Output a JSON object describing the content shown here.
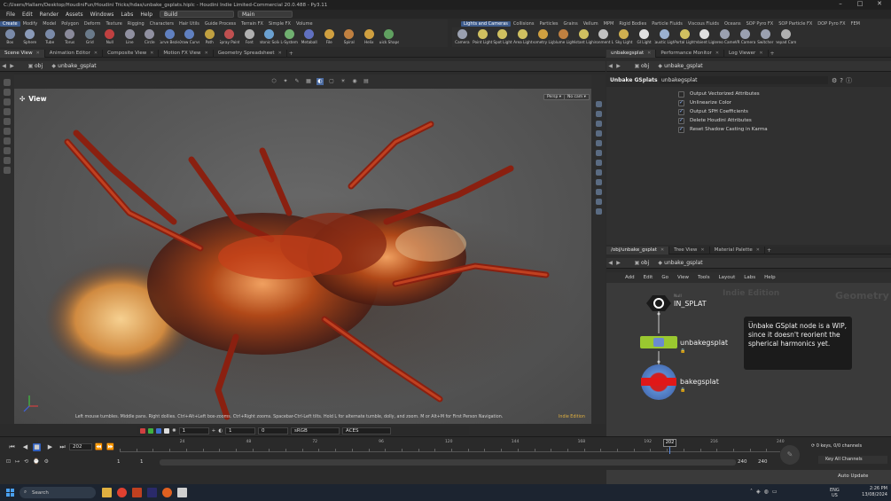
{
  "app": {
    "title": "C:/Users/Hallam/Desktop/HoudiniFun/Houdini Tricks/hdas/unbake_gsplats.hiplc - Houdini Indie Limited-Commercial 20.0.488 - Py3.11"
  },
  "menu": [
    "File",
    "Edit",
    "Render",
    "Assets",
    "Windows",
    "Labs",
    "Help"
  ],
  "desktops": {
    "build": "Build",
    "main": "Main"
  },
  "shelf_tabs_left": [
    "Create",
    "Modify",
    "Model",
    "Polygon",
    "Deform",
    "Texture",
    "Rigging",
    "Characters",
    "Hair Utils",
    "Guide Process",
    "Terrain FX",
    "Simple FX",
    "Volume"
  ],
  "shelf_tabs_right": [
    "Lights and Cameras",
    "Collisions",
    "Particles",
    "Grains",
    "Vellum",
    "MPM",
    "Rigid Bodies",
    "Particle Fluids",
    "Viscous Fluids",
    "Oceans",
    "SOP Pyro FX",
    "SOP Particle FX",
    "DOP Pyro FX",
    "FEM"
  ],
  "tools_left": [
    {
      "label": "Box",
      "color": "#7a8aa8"
    },
    {
      "label": "Sphere",
      "color": "#8a9ab8"
    },
    {
      "label": "Tube",
      "color": "#7a8aa8"
    },
    {
      "label": "Torus",
      "color": "#8a8a9a"
    },
    {
      "label": "Grid",
      "color": "#6a7a8a"
    },
    {
      "label": "Null",
      "color": "#c04040"
    },
    {
      "label": "Line",
      "color": "#9090a0"
    },
    {
      "label": "Circle",
      "color": "#9090a0"
    },
    {
      "label": "Curve Bezier",
      "color": "#6080c0"
    },
    {
      "label": "Draw Curve",
      "color": "#6080c0"
    },
    {
      "label": "Path",
      "color": "#c0a040"
    },
    {
      "label": "Spray Paint",
      "color": "#c05050"
    },
    {
      "label": "Font",
      "color": "#b0b0b0"
    },
    {
      "label": "Platonic Solids",
      "color": "#6aa0d0"
    },
    {
      "label": "L-System",
      "color": "#70b070"
    },
    {
      "label": "Metaball",
      "color": "#6070c0"
    },
    {
      "label": "File",
      "color": "#d0a040"
    },
    {
      "label": "Spiral",
      "color": "#c08040"
    },
    {
      "label": "Helix",
      "color": "#d0a040"
    },
    {
      "label": "Quick Shapes",
      "color": "#60a060"
    }
  ],
  "tools_right": [
    {
      "label": "Camera",
      "color": "#9aa0b0"
    },
    {
      "label": "Point Light",
      "color": "#d0c060"
    },
    {
      "label": "Spot Light",
      "color": "#d0c060"
    },
    {
      "label": "Area Light",
      "color": "#d0c060"
    },
    {
      "label": "Geometry Light",
      "color": "#d0a040"
    },
    {
      "label": "Volume Light",
      "color": "#c08040"
    },
    {
      "label": "Distant Light",
      "color": "#d0c060"
    },
    {
      "label": "Environment Light",
      "color": "#c0c0c0"
    },
    {
      "label": "Sky Light",
      "color": "#d0b050"
    },
    {
      "label": "GI Light",
      "color": "#e0e0e0"
    },
    {
      "label": "Caustic Light",
      "color": "#9ab0d0"
    },
    {
      "label": "Portal Light",
      "color": "#d0c060"
    },
    {
      "label": "Ambient Light",
      "color": "#e0e0e0"
    },
    {
      "label": "Stereo Camera",
      "color": "#9aa0b0"
    },
    {
      "label": "VR Camera",
      "color": "#9aa0b0"
    },
    {
      "label": "Switcher",
      "color": "#9aa0b0"
    },
    {
      "label": "Gamepad Camera",
      "color": "#b0b0b0"
    }
  ],
  "left_tabs": [
    {
      "label": "Scene View"
    },
    {
      "label": "Animation Editor"
    },
    {
      "label": "Composite View"
    },
    {
      "label": "Motion FX View"
    },
    {
      "label": "Geometry Spreadsheet"
    }
  ],
  "path": {
    "obj": "obj",
    "node": "unbake_gsplat"
  },
  "viewport": {
    "label": "View",
    "persp": "Persp ▾",
    "cam": "No cam ▾",
    "hint": "Left mouse tumbles. Middle pans. Right dollies. Ctrl+Alt+Left box-zooms. Ctrl+Right zooms. Spacebar-Ctrl-Left tilts. Hold L for alternate tumble, dolly, and zoom. M or Alt+M for First Person Navigation.",
    "edition": "Indie Edition"
  },
  "vpfoot": {
    "f1": "1",
    "f2": "1",
    "f3": "0",
    "cs": "sRGB",
    "aces": "ACES"
  },
  "timeline": {
    "frame": "202",
    "marker": "202",
    "start1": "1",
    "start2": "1",
    "end1": "240",
    "end2": "240",
    "keys": "0 keys, 0/0 channels",
    "keyall": "Key All Channels",
    "autoupdate": "Auto Update",
    "ticks": [
      "24",
      "48",
      "72",
      "96",
      "120",
      "144",
      "168",
      "192",
      "216",
      "240"
    ]
  },
  "right_top_tabs": [
    {
      "label": "unbakegsplat"
    },
    {
      "label": "Performance Monitor"
    },
    {
      "label": "Log Viewer"
    }
  ],
  "params": {
    "type": "Unbake GSplats",
    "name": "unbakegsplat",
    "items": [
      {
        "label": "Output Vectorized Attributes",
        "on": false
      },
      {
        "label": "Unlinearize Color",
        "on": true
      },
      {
        "label": "Output SPH Coefficients",
        "on": true
      },
      {
        "label": "Delete Houdini Attributes",
        "on": true
      },
      {
        "label": "Reset Shadow Casting in Karma",
        "on": true
      }
    ]
  },
  "right_bot_tabs": [
    {
      "label": "/obj/unbake_gsplat"
    },
    {
      "label": "Tree View"
    },
    {
      "label": "Material Palette"
    }
  ],
  "netmenu": [
    "Add",
    "Edit",
    "Go",
    "View",
    "Tools",
    "Layout",
    "Labs",
    "Help"
  ],
  "network": {
    "watermark1": "Indie Edition",
    "watermark2": "Geometry",
    "null_type": "Null",
    "n1": "IN_SPLAT",
    "n2": "unbakegsplat",
    "n3": "bakegsplat",
    "sticky_dash": "—",
    "sticky": "Unbake GSplat node is a WIP, since it doesn't reorient the spherical harmonics yet."
  },
  "taskbar": {
    "search": "Search",
    "lang": "ENG",
    "region": "US",
    "time": "2:26 PM",
    "date": "13/08/2024"
  }
}
